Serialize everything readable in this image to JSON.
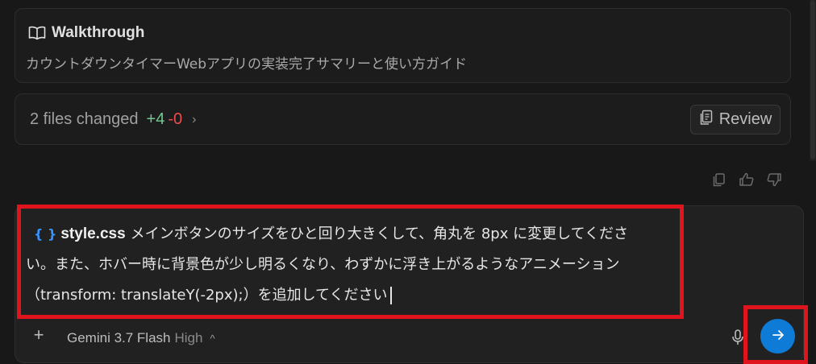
{
  "walkthrough": {
    "title": "Walkthrough",
    "description": "カウントダウンタイマーWebアプリの実装完了サマリーと使い方ガイド",
    "icon": "book-open-icon"
  },
  "changes": {
    "summary": "2 files changed",
    "additions": "+4",
    "deletions": "-0",
    "review_label": "Review"
  },
  "feedback": {
    "icons": [
      "copy-icon",
      "thumbs-up-icon",
      "thumbs-down-icon"
    ]
  },
  "prompt": {
    "chip_icon": "{ }",
    "chip_file": "style.css",
    "text": "メインボタンのサイズをひと回り大きくして、角丸を 8px に変更してください。また、ホバー時に背景色が少し明るくなり、わずかに浮き上がるようなアニメーション（transform: translateY(-2px);）を追加してください"
  },
  "toolbar": {
    "plus_label": "+",
    "model_name": "Gemini 3.7 Flash",
    "model_level": "High"
  },
  "colors": {
    "additions": "#73c991",
    "deletions": "#f14c4c",
    "send_button": "#0e7bd6",
    "highlight": "#e0141c"
  }
}
